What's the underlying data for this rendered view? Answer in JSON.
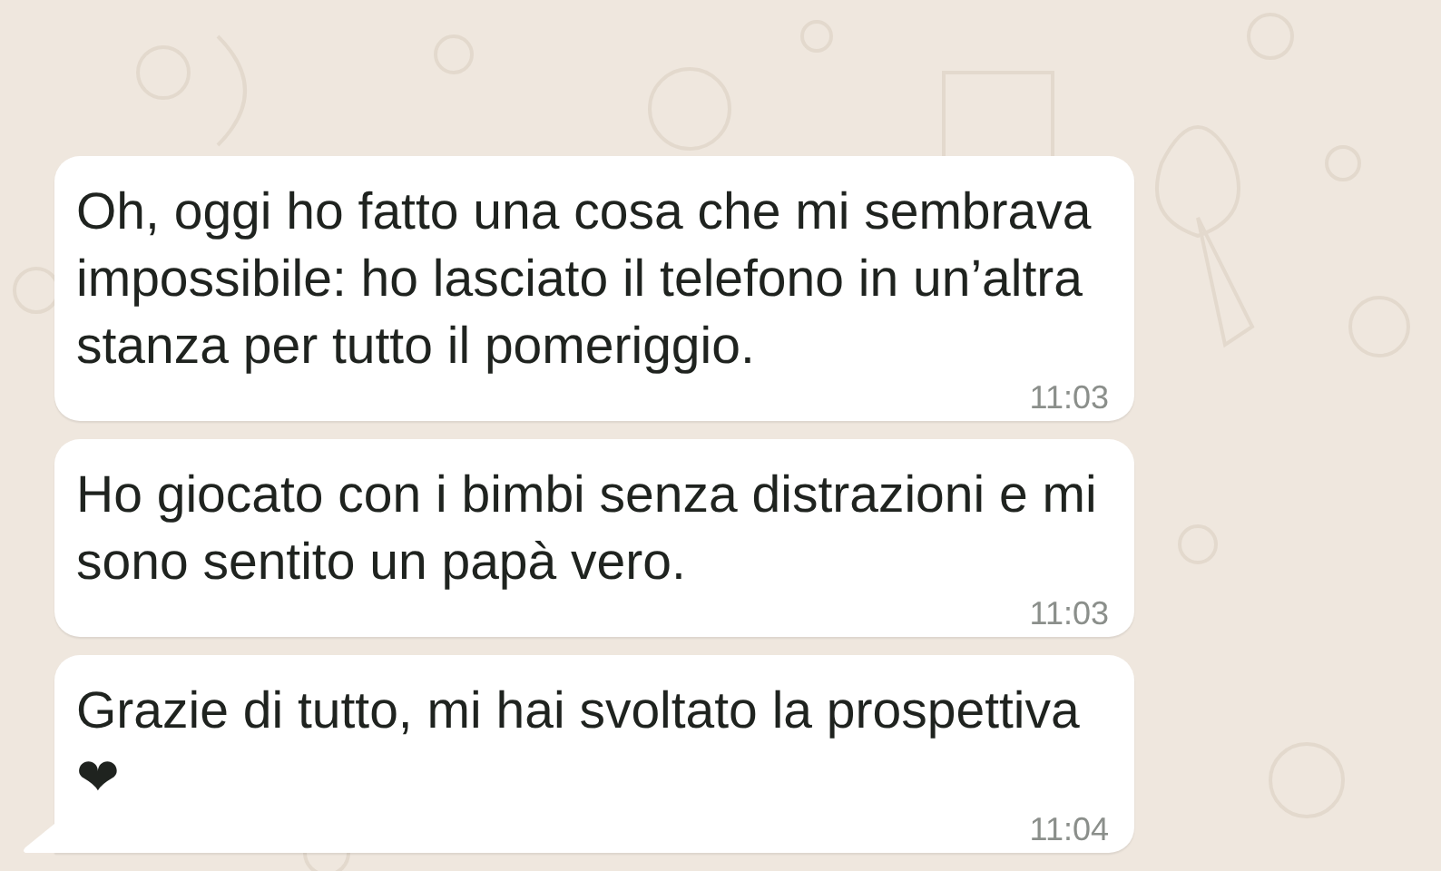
{
  "messages": [
    {
      "text": "Oh, oggi ho fatto una cosa che mi sembrava impossibile: ho lasciato il telefono in un’altra stanza per tutto il pomeriggio.",
      "time": "11:03",
      "tail": false
    },
    {
      "text": "Ho giocato con i bimbi senza distrazioni e mi sono sentito un papà vero.",
      "time": "11:03",
      "tail": false
    },
    {
      "text": "Grazie di tutto, mi hai svoltato la prospettiva ❤",
      "time": "11:04",
      "tail": true
    }
  ]
}
